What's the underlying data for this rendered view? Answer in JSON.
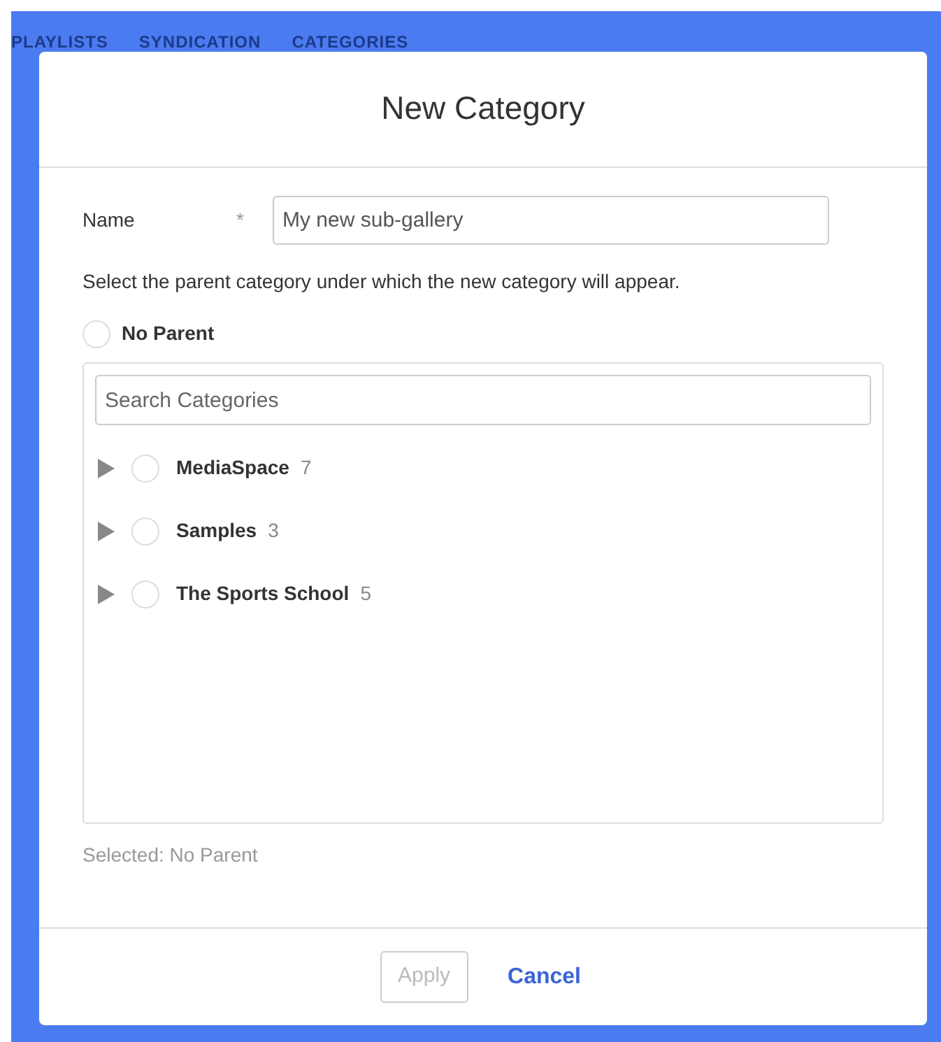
{
  "backdrop_tabs": [
    "PLAYLISTS",
    "SYNDICATION",
    "CATEGORIES"
  ],
  "dialog": {
    "title": "New Category",
    "name_field": {
      "label": "Name",
      "required_mark": "*",
      "value": "My new sub-gallery"
    },
    "instruction": "Select the parent category under which the new category will appear.",
    "no_parent": {
      "label": "No Parent",
      "selected": false
    },
    "search": {
      "placeholder": "Search Categories"
    },
    "categories": [
      {
        "name": "MediaSpace",
        "count": "7",
        "expanded": false,
        "selected": false
      },
      {
        "name": "Samples",
        "count": "3",
        "expanded": false,
        "selected": false
      },
      {
        "name": "The Sports School",
        "count": "5",
        "expanded": false,
        "selected": false
      }
    ],
    "selection_text": "Selected: No Parent",
    "buttons": [
      {
        "label": "Apply",
        "kind": "outline",
        "disabled": true
      },
      {
        "label": "Cancel",
        "kind": "link",
        "disabled": false
      }
    ]
  }
}
